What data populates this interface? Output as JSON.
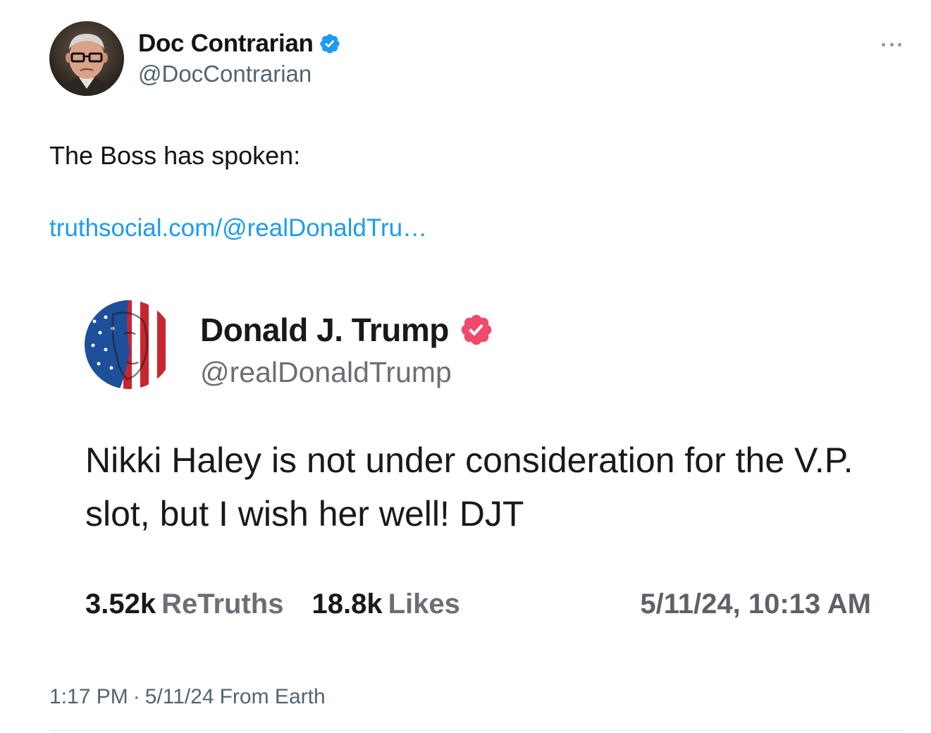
{
  "tweet": {
    "author": {
      "display_name": "Doc Contrarian",
      "handle": "@DocContrarian",
      "verified": true,
      "avatar_icon": "profile-photo-icon"
    },
    "text": "The Boss has spoken:",
    "link": "truthsocial.com/@realDonaldTru…",
    "more_icon": "more-horizontal-icon",
    "meta": {
      "time": "1:17 PM",
      "separator": "·",
      "date": "5/11/24",
      "source": "From Earth"
    }
  },
  "embedded_post": {
    "author": {
      "display_name": "Donald J. Trump",
      "handle": "@realDonaldTrump",
      "verified": true
    },
    "text": "Nikki Haley is not under consideration for the V.P. slot, but I wish her well! DJT",
    "stats": {
      "retruths_count": "3.52k",
      "retruths_label": "ReTruths",
      "likes_count": "18.8k",
      "likes_label": "Likes"
    },
    "timestamp": "5/11/24, 10:13 AM"
  },
  "colors": {
    "link": "#1d9bf0",
    "verified_blue": "#1d9bf0",
    "truth_verified": "#f0496b",
    "secondary_text": "#536471"
  }
}
